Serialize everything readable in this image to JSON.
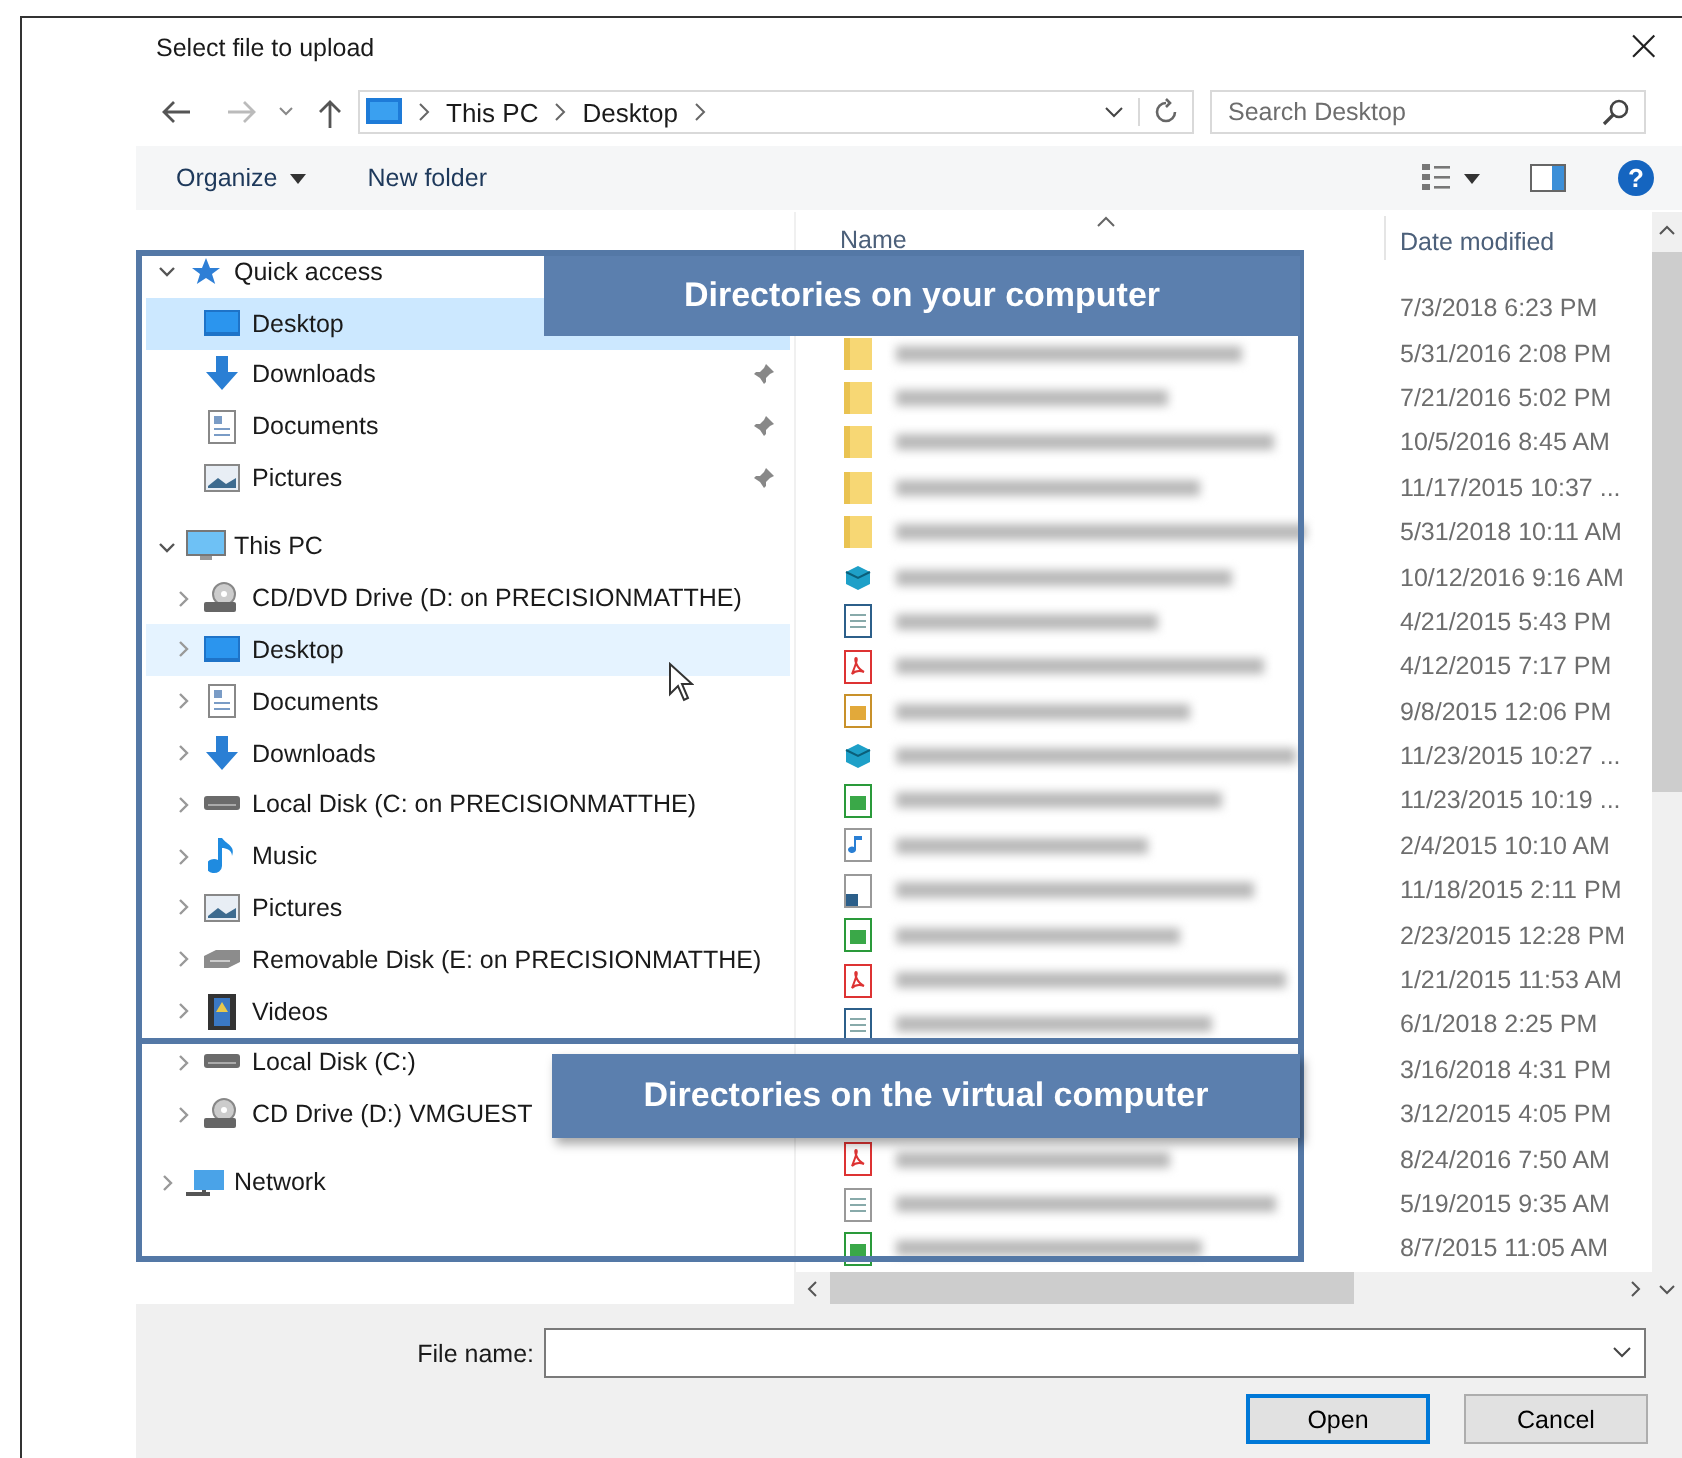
{
  "window": {
    "title": "Select file to upload",
    "close": "×"
  },
  "address": {
    "path": [
      "This PC",
      "Desktop"
    ],
    "search_placeholder": "Search Desktop"
  },
  "toolbar": {
    "organize": "Organize",
    "new_folder": "New folder",
    "help": "?"
  },
  "nav": [
    {
      "label": "Quick access",
      "kind": "star",
      "expanded": true,
      "selected": false,
      "hovered": false,
      "children": [
        {
          "label": "Desktop",
          "kind": "desktop",
          "selected": true,
          "hovered": false
        },
        {
          "label": "Downloads",
          "kind": "download",
          "pinned": true,
          "selected": false,
          "hovered": false
        },
        {
          "label": "Documents",
          "kind": "documents",
          "pinned": true,
          "selected": false,
          "hovered": false
        },
        {
          "label": "Pictures",
          "kind": "pictures",
          "pinned": true,
          "selected": false,
          "hovered": false
        }
      ]
    },
    {
      "label": "This PC",
      "kind": "pc",
      "expanded": true,
      "selected": false,
      "hovered": false,
      "children": [
        {
          "label": "CD/DVD Drive (D: on PRECISIONMATTHE)",
          "kind": "cd",
          "expanded": false,
          "selected": false,
          "hovered": false
        },
        {
          "label": "Desktop",
          "kind": "desktop",
          "expanded": false,
          "selected": false,
          "hovered": true
        },
        {
          "label": "Documents",
          "kind": "documents",
          "expanded": false,
          "selected": false,
          "hovered": false
        },
        {
          "label": "Downloads",
          "kind": "download",
          "expanded": false,
          "selected": false,
          "hovered": false
        },
        {
          "label": "Local Disk (C: on PRECISIONMATTHE)",
          "kind": "disk",
          "expanded": false,
          "selected": false,
          "hovered": false
        },
        {
          "label": "Music",
          "kind": "music",
          "expanded": false,
          "selected": false,
          "hovered": false
        },
        {
          "label": "Pictures",
          "kind": "pictures",
          "expanded": false,
          "selected": false,
          "hovered": false
        },
        {
          "label": "Removable Disk (E: on PRECISIONMATTHE)",
          "kind": "removable",
          "expanded": false,
          "selected": false,
          "hovered": false
        },
        {
          "label": "Videos",
          "kind": "videos",
          "expanded": false,
          "selected": false,
          "hovered": false
        },
        {
          "label": "Local Disk (C:)",
          "kind": "disk",
          "expanded": false,
          "selected": false,
          "hovered": false
        },
        {
          "label": "CD Drive (D:) VMGUEST",
          "kind": "cd",
          "expanded": false,
          "selected": false,
          "hovered": false
        }
      ]
    },
    {
      "label": "Network",
      "kind": "network",
      "expanded": false,
      "selected": false,
      "hovered": false
    }
  ],
  "table": {
    "columns": [
      "Name",
      "Date modified"
    ],
    "rows": [
      {
        "date": "7/3/2018 6:23 PM"
      },
      {
        "kind": "folder",
        "date": "5/31/2016 2:08 PM"
      },
      {
        "kind": "folder",
        "date": "7/21/2016 5:02 PM"
      },
      {
        "kind": "folder",
        "date": "10/5/2016 8:45 AM"
      },
      {
        "kind": "folder",
        "date": "11/17/2015 10:37 ..."
      },
      {
        "kind": "folder",
        "date": "5/31/2018 10:11 AM"
      },
      {
        "kind": "app",
        "date": "10/12/2016 9:16 AM"
      },
      {
        "kind": "doc",
        "date": "4/21/2015 5:43 PM"
      },
      {
        "kind": "pdf",
        "date": "4/12/2015 7:17 PM"
      },
      {
        "kind": "draw",
        "date": "9/8/2015 12:06 PM"
      },
      {
        "kind": "app",
        "date": "11/23/2015 10:27 ..."
      },
      {
        "kind": "sheet",
        "date": "11/23/2015 10:19 ..."
      },
      {
        "kind": "audio",
        "date": "2/4/2015 10:10 AM"
      },
      {
        "kind": "shortcut",
        "date": "11/18/2015 2:11 PM"
      },
      {
        "kind": "sheet",
        "date": "2/23/2015 12:28 PM"
      },
      {
        "kind": "pdf",
        "date": "1/21/2015 11:53 AM"
      },
      {
        "kind": "doc",
        "date": "6/1/2018 2:25 PM"
      },
      {
        "date": "3/16/2018 4:31 PM"
      },
      {
        "date": "3/12/2015 4:05 PM"
      },
      {
        "kind": "pdf",
        "date": "8/24/2016 7:50 AM"
      },
      {
        "kind": "text",
        "date": "5/19/2015 9:35 AM"
      },
      {
        "kind": "sheet",
        "date": "8/7/2015 11:05 AM"
      }
    ]
  },
  "footer": {
    "file_name_label": "File name:",
    "buttons": [
      "Open",
      "Cancel"
    ]
  },
  "annotations": [
    "Directories on your computer",
    "Directories on the virtual computer"
  ]
}
